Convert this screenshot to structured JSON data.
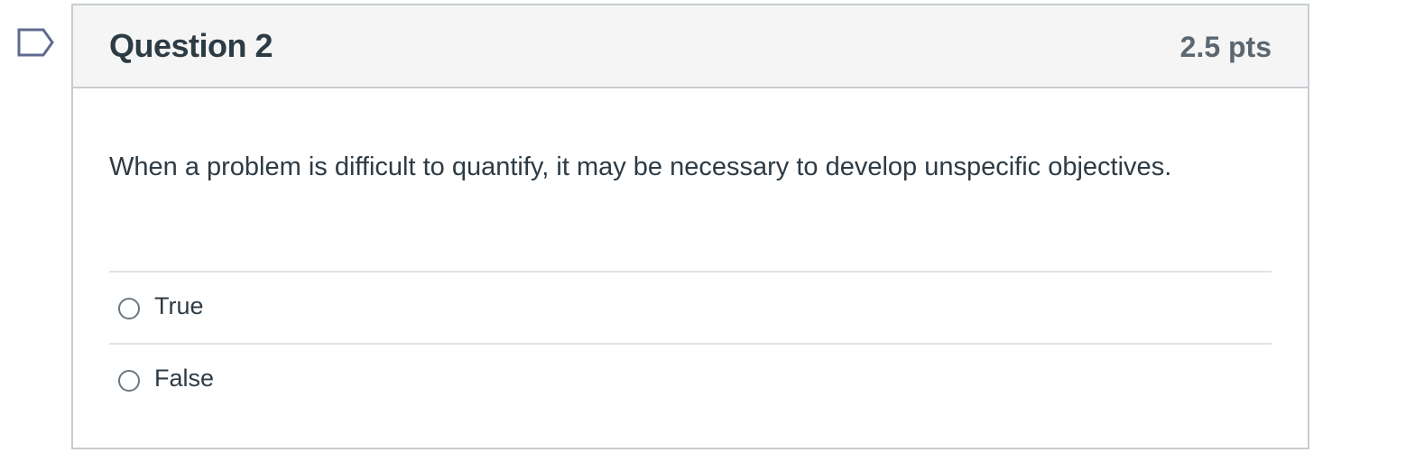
{
  "question": {
    "title": "Question 2",
    "points": "2.5 pts",
    "text": "When a problem is difficult to quantify, it may be necessary to develop unspecific objectives.",
    "flag_icon": "flag-icon",
    "answers": [
      {
        "label": "True",
        "selected": false
      },
      {
        "label": "False",
        "selected": false
      }
    ]
  },
  "colors": {
    "header_bg": "#f5f5f5",
    "border": "#c7cdd1",
    "text": "#2d3b45",
    "points_text": "#5b6770",
    "flag_outline": "#5f6a8f"
  }
}
